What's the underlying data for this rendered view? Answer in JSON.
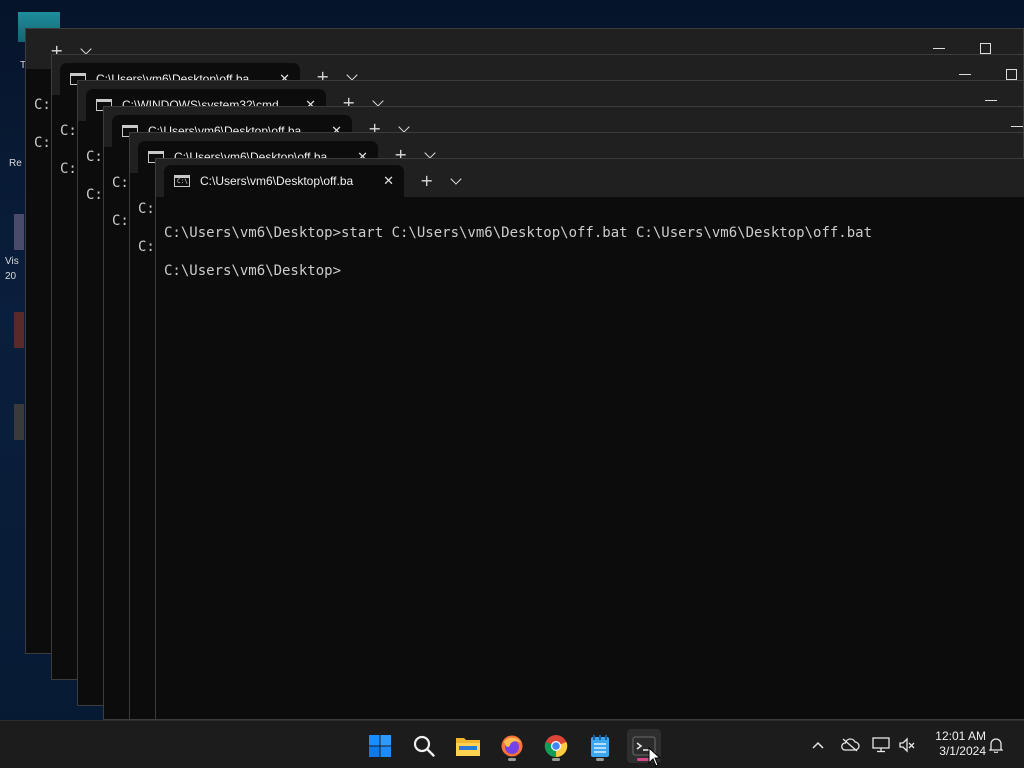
{
  "desktop": {
    "icon_labels": [
      "T",
      "Re",
      "Vis",
      "20"
    ]
  },
  "windows": [
    {
      "tab_title": "C:\\Users\\vm6\\Desktop\\off.ba",
      "prompt_lines": [
        "C:",
        "C:"
      ]
    },
    {
      "tab_title": "C:\\WINDOWS\\system32\\cmd",
      "prompt_lines": [
        "C:",
        "C:"
      ]
    },
    {
      "tab_title": "C:\\Users\\vm6\\Desktop\\off.ba",
      "prompt_lines": [
        "C:",
        "C:"
      ]
    },
    {
      "tab_title": "C:\\Users\\vm6\\Desktop\\off.ba",
      "prompt_lines": [
        "C:",
        "C:"
      ]
    },
    {
      "tab_title": "C:\\Users\\vm6\\Desktop\\off.ba",
      "prompt_lines": [
        "C:",
        "C:"
      ]
    }
  ],
  "active_terminal": {
    "tab_title": "C:\\Users\\vm6\\Desktop\\off.ba",
    "tab_icon_text": "C:\\",
    "lines": [
      "C:\\Users\\vm6\\Desktop>start C:\\Users\\vm6\\Desktop\\off.bat C:\\Users\\vm6\\Desktop\\off.bat",
      "C:\\Users\\vm6\\Desktop>"
    ]
  },
  "icons": {
    "new_tab": "+",
    "close": "✕"
  },
  "taskbar": {
    "apps": [
      "start-icon",
      "search-icon",
      "file-explorer-icon",
      "firefox-icon",
      "chrome-icon",
      "notepad-icon",
      "terminal-icon"
    ],
    "clock": {
      "time": "12:01 AM",
      "date": "3/1/2024"
    }
  },
  "colors": {
    "terminal_bg": "#0c0c0c",
    "titlebar_bg": "#202020",
    "taskbar_bg": "#1c1c1c",
    "accent_pink": "#d6478a",
    "win_blue": "#0a84ff"
  }
}
